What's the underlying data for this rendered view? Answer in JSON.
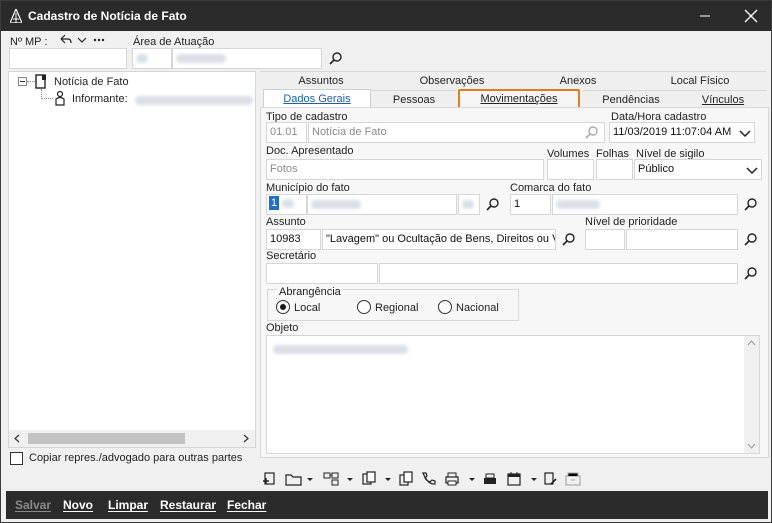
{
  "window": {
    "title": "Cadastro de Notícia de Fato"
  },
  "header": {
    "nmp_label": "Nº MP :",
    "area_label": "Área de Atuação"
  },
  "tree": {
    "root_label": "Notícia de Fato",
    "child_label": "Informante:"
  },
  "copy_checkbox_label": "Copiar repres./advogado para outras partes",
  "tabs_row1": [
    {
      "label": "Assuntos"
    },
    {
      "label": "Observações"
    },
    {
      "label": "Anexos"
    },
    {
      "label": "Local Físico"
    }
  ],
  "tabs_row2": [
    {
      "label": "Dados Gerais"
    },
    {
      "label": "Pessoas"
    },
    {
      "label": "Movimentações"
    },
    {
      "label": "Pendências"
    },
    {
      "label": "Vínculos"
    }
  ],
  "form": {
    "tipo_label": "Tipo de cadastro",
    "tipo_code": "01.01",
    "tipo_value": "Notícia de Fato",
    "datahora_label": "Data/Hora cadastro",
    "datahora_value": "11/03/2019 11:07:04 AM",
    "doc_label": "Doc. Apresentado",
    "doc_value": "Fotos",
    "volumes_label": "Volumes",
    "folhas_label": "Folhas",
    "sigilo_label": "Nível de sigilo",
    "sigilo_value": "Público",
    "municipio_label": "Município do fato",
    "municipio_code": "1",
    "comarca_label": "Comarca do fato",
    "comarca_code": "1",
    "assunto_label": "Assunto",
    "assunto_code": "10983",
    "assunto_value": "\"Lavagem\" ou Ocultação de Bens, Direitos ou V",
    "prioridade_label": "Nível de prioridade",
    "secretario_label": "Secretário",
    "abrangencia_label": "Abrangência",
    "radio_local": "Local",
    "radio_regional": "Regional",
    "radio_nacional": "Nacional",
    "objeto_label": "Objeto"
  },
  "bottom": {
    "salvar": "Salvar",
    "novo": "Novo",
    "limpar": "Limpar",
    "restaurar": "Restaurar",
    "fechar": "Fechar"
  },
  "colors": {
    "titlebar": "#2b2b2b",
    "highlight": "#e07f1a",
    "active_tab_text": "#1a5fb4"
  }
}
